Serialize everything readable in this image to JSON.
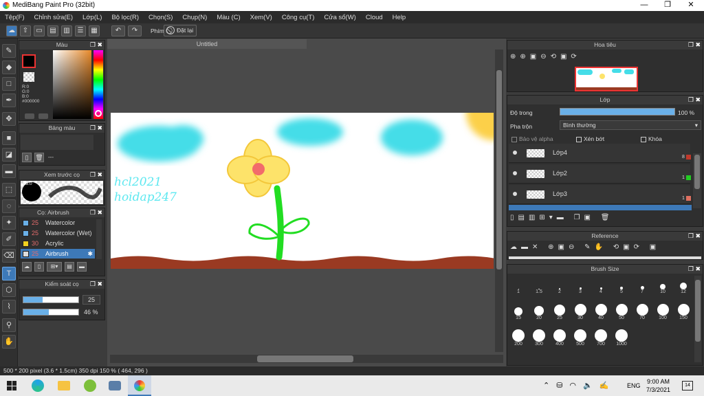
{
  "window": {
    "title": "MediBang Paint Pro (32bit)",
    "minimize": "—",
    "maximize": "❐",
    "close": "✕"
  },
  "menu": [
    "Tệp(F)",
    "Chỉnh sửa(E)",
    "Lớp(L)",
    "Bộ lọc(R)",
    "Chọn(S)",
    "Chụp(N)",
    "Màu (C)",
    "Xem(V)",
    "Công cụ(T)",
    "Cửa sổ(W)",
    "Cloud",
    "Help"
  ],
  "toolbar": {
    "key_label": "Phím",
    "reset_label": "Đặt lại"
  },
  "color_panel": {
    "title": "Màu",
    "r": "R:0",
    "g": "G:0",
    "b": "B:0",
    "hex": "#000000"
  },
  "palette_panel": {
    "title": "Bảng màu",
    "dash": "---"
  },
  "brush_preview": {
    "title": "Xem trước cọ",
    "size": "25.0"
  },
  "brush_panel": {
    "title": "Cọ: Airbrush",
    "items": [
      {
        "num": "25",
        "name": "Watercolor",
        "color": "#6ab0e8"
      },
      {
        "num": "25",
        "name": "Watercolor (Wet)",
        "color": "#6ab0e8"
      },
      {
        "num": "30",
        "name": "Acrylic",
        "color": "#f0d020"
      },
      {
        "num": "25",
        "name": "Airbrush",
        "color": "#dddddd"
      }
    ]
  },
  "brush_control": {
    "title": "Kiểm soát cọ",
    "size": "25",
    "opacity": "46 %",
    "size_level": 0.35,
    "opacity_level": 0.46
  },
  "document": {
    "tab": "Untitled",
    "text1": "hcl2021",
    "text2": "hoidap247"
  },
  "navigator": {
    "title": "Hoa tiêu"
  },
  "layer_panel": {
    "title": "Lớp",
    "opacity_label": "Độ trong",
    "opacity_value": "100 %",
    "blend_label": "Pha trộn",
    "blend_value": "Bình thường",
    "protect_alpha": "Bảo vệ alpha",
    "clipping": "Xén bớt",
    "lock": "Khóa",
    "layers": [
      {
        "name": "Lớp4",
        "badge": "8",
        "color": "#c0392b"
      },
      {
        "name": "Lớp2",
        "badge": "1",
        "color": "#22cc22"
      },
      {
        "name": "Lớp3",
        "badge": "1",
        "color": "#e07060"
      }
    ]
  },
  "reference_panel": {
    "title": "Reference"
  },
  "brushsize_panel": {
    "title": "Brush Size",
    "sizes": [
      "1",
      "1.5",
      "2",
      "3",
      "4",
      "5",
      "7",
      "10",
      "12",
      "15",
      "20",
      "25",
      "30",
      "40",
      "50",
      "70",
      "100",
      "150",
      "200",
      "300",
      "400",
      "500",
      "700",
      "1000"
    ]
  },
  "status": "500 * 200 pixel   (3.6 * 1.5cm)   350 dpi   150 %   ( 464, 296 )",
  "taskbar": {
    "lang": "ENG",
    "time": "9:00 AM",
    "date": "7/3/2021",
    "notif": "14"
  }
}
